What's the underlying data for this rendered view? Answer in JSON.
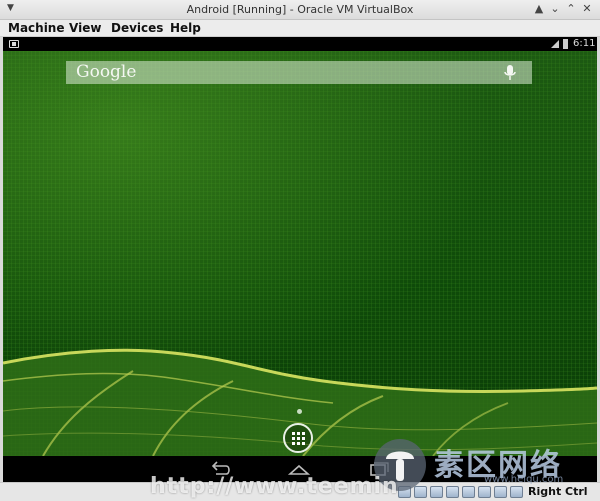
{
  "window": {
    "title": "Android [Running] - Oracle VM VirtualBox",
    "controls": [
      "window-menu",
      "up",
      "minimize",
      "maximize",
      "close"
    ]
  },
  "menubar": {
    "items": [
      "Machine",
      "View",
      "Devices",
      "Help"
    ]
  },
  "android": {
    "statusbar": {
      "time": "6:11"
    },
    "search": {
      "label": "Google"
    },
    "colors": {
      "wallpaper": "#0e4a09",
      "leaf_vein": "#c8d85a"
    }
  },
  "vbox_status": {
    "host_key": "Right Ctrl"
  },
  "watermark": {
    "url": "http://www.teemin",
    "brand_cn": "素区网络",
    "site": "www.heiqu.com"
  }
}
